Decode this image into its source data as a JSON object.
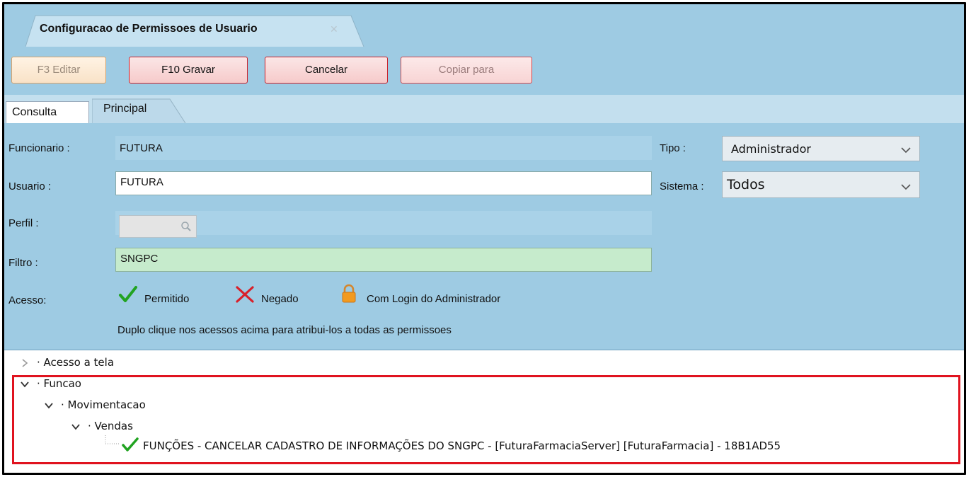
{
  "window": {
    "tab_title": "Configuracao de Permissoes de Usuario",
    "tab_close": "✕"
  },
  "toolbar": {
    "edit_label": "F3 Editar",
    "save_label": "F10 Gravar",
    "cancel_label": "Cancelar",
    "copy_label": "Copiar para"
  },
  "page_tabs": {
    "consulta": "Consulta",
    "principal": "Principal"
  },
  "form": {
    "funcionario_label": "Funcionario :",
    "funcionario_value": "FUTURA",
    "usuario_label": "Usuario :",
    "usuario_value": "FUTURA",
    "perfil_label": "Perfil :",
    "perfil_value": "",
    "filtro_label": "Filtro :",
    "filtro_value": "SNGPC",
    "tipo_label": "Tipo :",
    "tipo_value": "Administrador",
    "sistema_label": "Sistema :",
    "sistema_value": "Todos",
    "acesso_label": "Acesso:",
    "permitido_label": "Permitido",
    "negado_label": "Negado",
    "admin_login_label": "Com Login do Administrador",
    "hint": "Duplo clique nos acessos acima para atribui-los a todas as permissoes"
  },
  "tree": {
    "acesso_tela": "Acesso a tela",
    "funcao": "Funcao",
    "movimentacao": "Movimentacao",
    "vendas": "Vendas",
    "leaf": "FUNÇÕES - CANCELAR CADASTRO DE INFORMAÇÕES DO SNGPC - [FuturaFarmaciaServer] [FuturaFarmacia]  - 18B1AD55"
  },
  "colors": {
    "panel_blue": "#9ecbe3",
    "highlight_red": "#e0131f",
    "filter_green": "#c6ebcc",
    "check_green": "#21a321",
    "cross_red": "#d8202a",
    "lock_orange": "#f29a1f"
  },
  "icons": {
    "close": "close-icon",
    "lookup": "magnifier-icon",
    "permitido": "checkmark-icon",
    "negado": "cross-icon",
    "admin": "lock-icon",
    "dropdown": "chevron-down-icon",
    "expand": "chevron-right-icon"
  }
}
